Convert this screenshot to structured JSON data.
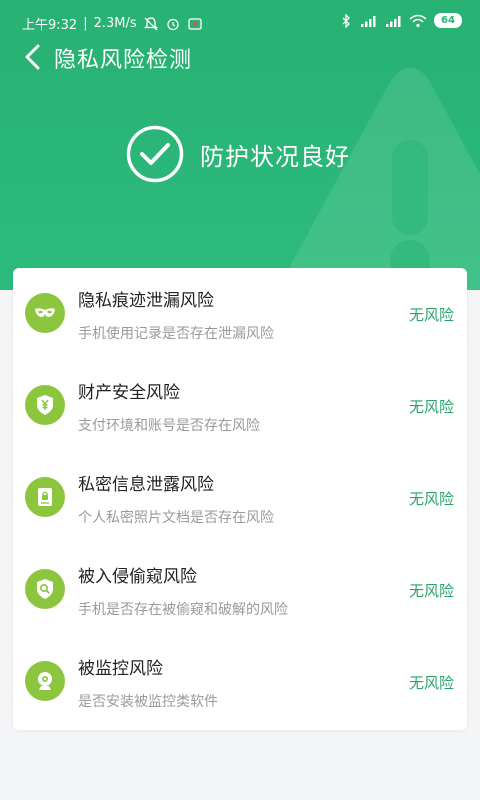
{
  "status_bar": {
    "time": "上午9:32",
    "speed": "2.3M/s",
    "battery": "64"
  },
  "header": {
    "title": "隐私风险检测",
    "status_text": "防护状况良好"
  },
  "risks": [
    {
      "title": "隐私痕迹泄漏风险",
      "desc": "手机使用记录是否存在泄漏风险",
      "status": "无风险",
      "icon": "mask-icon"
    },
    {
      "title": "财产安全风险",
      "desc": "支付环境和账号是否存在风险",
      "status": "无风险",
      "icon": "shield-yen-icon"
    },
    {
      "title": "私密信息泄露风险",
      "desc": "个人私密照片文档是否存在风险",
      "status": "无风险",
      "icon": "locked-document-icon"
    },
    {
      "title": "被入侵偷窥风险",
      "desc": "手机是否存在被偷窥和破解的风险",
      "status": "无风险",
      "icon": "shield-search-icon"
    },
    {
      "title": "被监控风险",
      "desc": "是否安装被监控类软件",
      "status": "无风险",
      "icon": "camera-icon"
    }
  ],
  "colors": {
    "header_green": "#27b173",
    "icon_green": "#8cc63f",
    "status_green": "#2aa36b"
  }
}
